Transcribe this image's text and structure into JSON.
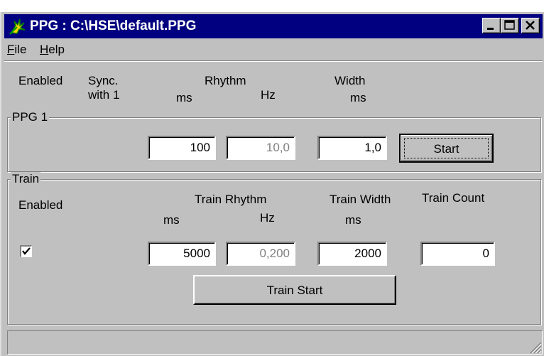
{
  "window": {
    "title": "PPG : C:\\HSE\\default.PPG",
    "icon": "ppg-app-icon"
  },
  "menu": [
    "File",
    "Help"
  ],
  "header": {
    "enabled": "Enabled",
    "sync_line1": "Sync.",
    "sync_line2": "with 1",
    "rhythm": "Rhythm",
    "rhythm_ms": "ms",
    "rhythm_hz": "Hz",
    "width": "Width",
    "width_ms": "ms"
  },
  "ppg1": {
    "title": "PPG 1",
    "rhythm_ms": "100",
    "rhythm_hz": "10,0",
    "width_ms": "1,0",
    "start_label": "Start"
  },
  "train": {
    "title": "Train",
    "enabled_label": "Enabled",
    "rhythm_label": "Train Rhythm",
    "rhythm_ms_unit": "ms",
    "rhythm_hz_unit": "Hz",
    "width_label": "Train Width",
    "width_ms_unit": "ms",
    "count_label": "Train Count",
    "enabled_checked": true,
    "rhythm_ms": "5000",
    "rhythm_hz": "0,200",
    "width_ms": "2000",
    "count": "0",
    "start_label": "Train Start"
  },
  "colors": {
    "titlebar": "#000080",
    "face": "#c0c0c0"
  }
}
